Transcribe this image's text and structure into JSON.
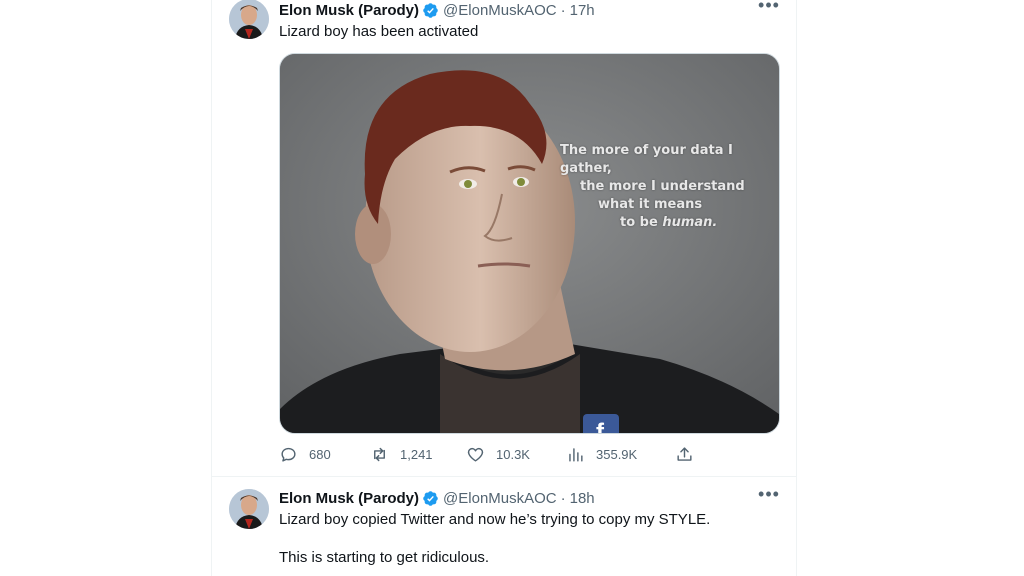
{
  "tweets": [
    {
      "author_name": "Elon Musk (Parody)",
      "handle": "@ElonMuskAOC",
      "separator": "·",
      "time": "17h",
      "text": "Lizard boy has been activated",
      "image_text": {
        "line1": "The more of your data I gather,",
        "line2": "the more I understand",
        "line3": "what it means",
        "line4_prefix": "to be ",
        "line4_emph": "human."
      },
      "image_logo": "f",
      "stats": {
        "replies": "680",
        "retweets": "1,241",
        "likes": "10.3K",
        "views": "355.9K"
      }
    },
    {
      "author_name": "Elon Musk (Parody)",
      "handle": "@ElonMuskAOC",
      "separator": "·",
      "time": "18h",
      "text_line1": "Lizard boy copied Twitter and now he’s trying to copy my STYLE.",
      "text_line2": "This is starting to get ridiculous."
    }
  ],
  "colors": {
    "verified": "#1d9bf0",
    "text_primary": "#0f1419",
    "text_secondary": "#536471",
    "border": "#eff3f4"
  },
  "icons": [
    "reply-icon",
    "retweet-icon",
    "like-icon",
    "views-icon",
    "share-icon",
    "more-icon",
    "verified-badge-icon"
  ]
}
